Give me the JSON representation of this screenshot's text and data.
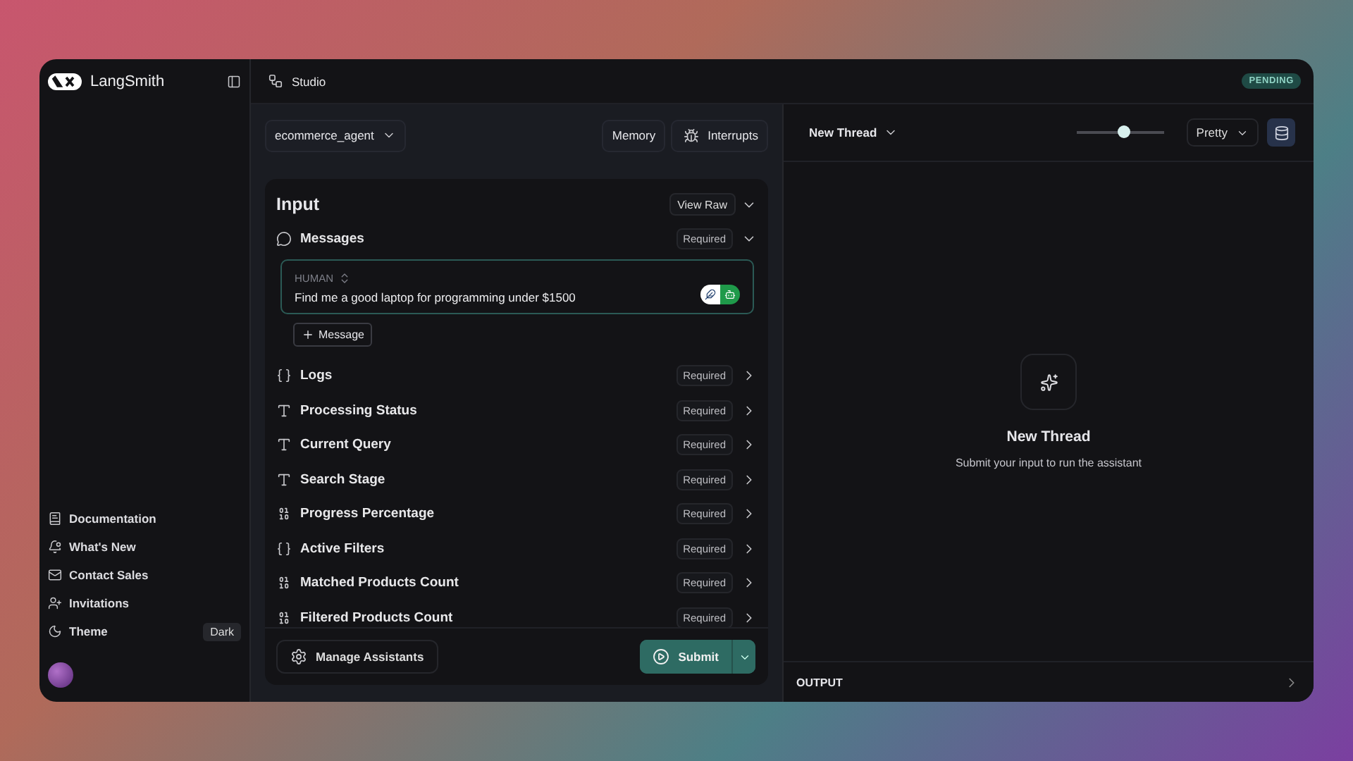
{
  "brand": "LangSmith",
  "topbar": {
    "title": "Studio",
    "status": "PENDING"
  },
  "sidebar": {
    "items": [
      {
        "kind": "docs",
        "label": "Documentation"
      },
      {
        "kind": "news",
        "label": "What's New"
      },
      {
        "kind": "mail",
        "label": "Contact Sales"
      },
      {
        "kind": "invite",
        "label": "Invitations"
      },
      {
        "kind": "theme",
        "label": "Theme",
        "value": "Dark"
      }
    ]
  },
  "graph": {
    "assistant": "ecommerce_agent",
    "buttons": [
      {
        "kind": "memory",
        "label": "Memory"
      },
      {
        "kind": "interrupts",
        "label": "Interrupts"
      }
    ]
  },
  "input": {
    "title": "Input",
    "view_raw": "View Raw",
    "messages": {
      "label": "Messages",
      "badge": "Required",
      "role": "HUMAN",
      "text": "Find me a good laptop for programming under $1500",
      "add": "Message"
    },
    "fields": [
      {
        "kind": "object",
        "label": "Logs",
        "badge": "Required"
      },
      {
        "kind": "text",
        "label": "Processing Status",
        "badge": "Required"
      },
      {
        "kind": "text",
        "label": "Current Query",
        "badge": "Required"
      },
      {
        "kind": "text",
        "label": "Search Stage",
        "badge": "Required"
      },
      {
        "kind": "number",
        "label": "Progress Percentage",
        "badge": "Required"
      },
      {
        "kind": "object",
        "label": "Active Filters",
        "badge": "Required"
      },
      {
        "kind": "number",
        "label": "Matched Products Count",
        "badge": "Required"
      },
      {
        "kind": "number",
        "label": "Filtered Products Count",
        "badge": "Required"
      }
    ],
    "manage": "Manage Assistants",
    "submit": "Submit"
  },
  "thread": {
    "title": "New Thread",
    "zoom": {
      "level": 0.55
    },
    "format": "Pretty",
    "empty_title": "New Thread",
    "empty_text": "Submit your input to run the assistant",
    "output": "OUTPUT"
  }
}
